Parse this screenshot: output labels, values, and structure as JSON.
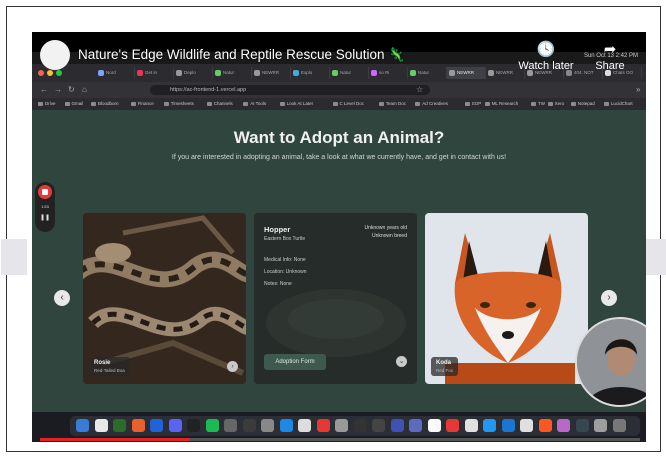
{
  "video": {
    "title": "Nature's Edge Wildlife and Reptile Rescue Solution",
    "title_emoji": "🦎",
    "watch_later_label": "Watch later",
    "share_label": "Share",
    "progress_fraction": 0.25
  },
  "mac": {
    "clock": "Sun Oct 13  2:42 PM"
  },
  "browser": {
    "tabs": [
      "Nord",
      "Get in",
      "Deplo",
      "Natur",
      "NEWRR",
      "Explo",
      "Natur",
      "so Ri",
      "Natur",
      "NEWRR",
      "NEWRR",
      "NEWRR",
      "404: NOT",
      "Chats OO"
    ],
    "url": "https://ac-frontend-1.vercel.app",
    "bookmarks": [
      "Drive",
      "Gmail",
      "Bloodborn",
      "Finance",
      "Timesheets",
      "Channels",
      "AI Tools",
      "Look At Later",
      "C Level Doc",
      "Team Doc",
      "Ad Creatives",
      "SOP",
      "ML Research",
      "TW",
      "Xero",
      "Notepad",
      "LucidChart"
    ]
  },
  "page": {
    "heading": "Want to Adopt an Animal?",
    "subheading": "If you are interested in adopting an animal, take a look at what we currently have, and get in contact with us!",
    "cards": [
      {
        "name": "Rosie",
        "species": "Red-Tailed Boa"
      },
      {
        "name": "Hopper",
        "species": "Eastern Box Turtle",
        "age": "Unknown years old",
        "breed": "Unknown breed",
        "medical": "Medical Info: None",
        "location": "Location: Unknown",
        "notes": "Notes: None",
        "button": "Adoption Form"
      },
      {
        "name": "Koda",
        "species": "Red Fox"
      }
    ]
  },
  "recorder": {
    "time": "1:53"
  },
  "icons": {
    "prev": "chevron-left-icon",
    "next": "chevron-right-icon",
    "pause": "pause-icon",
    "watch_later": "clock-icon",
    "share": "share-arrow-icon"
  }
}
